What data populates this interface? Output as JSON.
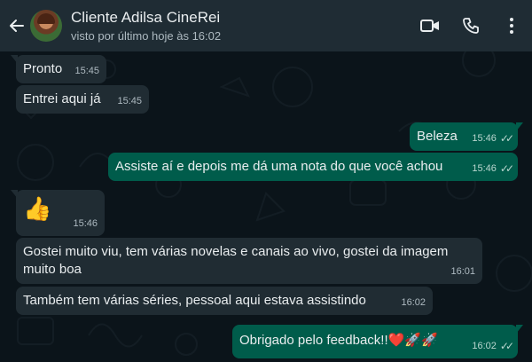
{
  "header": {
    "contact_name": "Cliente Adilsa CineRei",
    "last_seen": "visto por último hoje às 16:02",
    "icons": [
      "back-arrow-icon",
      "video-call-icon",
      "phone-icon",
      "more-vertical-icon"
    ]
  },
  "messages": [
    {
      "direction": "in",
      "text": "Pronto",
      "time": "15:45"
    },
    {
      "direction": "in",
      "text": "Entrei aqui já",
      "time": "15:45"
    },
    {
      "direction": "out",
      "text": "Beleza",
      "time": "15:46",
      "status": "read"
    },
    {
      "direction": "out",
      "text": "Assiste aí e depois me dá uma nota do que você achou",
      "time": "15:46",
      "status": "read"
    },
    {
      "direction": "in",
      "text": "👍",
      "time": "15:46"
    },
    {
      "direction": "in",
      "text": "Gostei muito viu, tem várias novelas e canais ao vivo, gostei da imagem muito boa",
      "time": "16:01"
    },
    {
      "direction": "in",
      "text": "Também tem várias séries, pessoal aqui estava assistindo",
      "time": "16:02"
    },
    {
      "direction": "out",
      "text": "Obrigado pelo feedback!!❤️🚀🚀",
      "time": "16:02",
      "status": "read"
    }
  ],
  "colors": {
    "header_bg": "#1f2c34",
    "chat_bg": "#0b141a",
    "incoming_bubble": "#202c33",
    "outgoing_bubble": "#005c4b",
    "read_ticks": "#b9d6cf"
  }
}
